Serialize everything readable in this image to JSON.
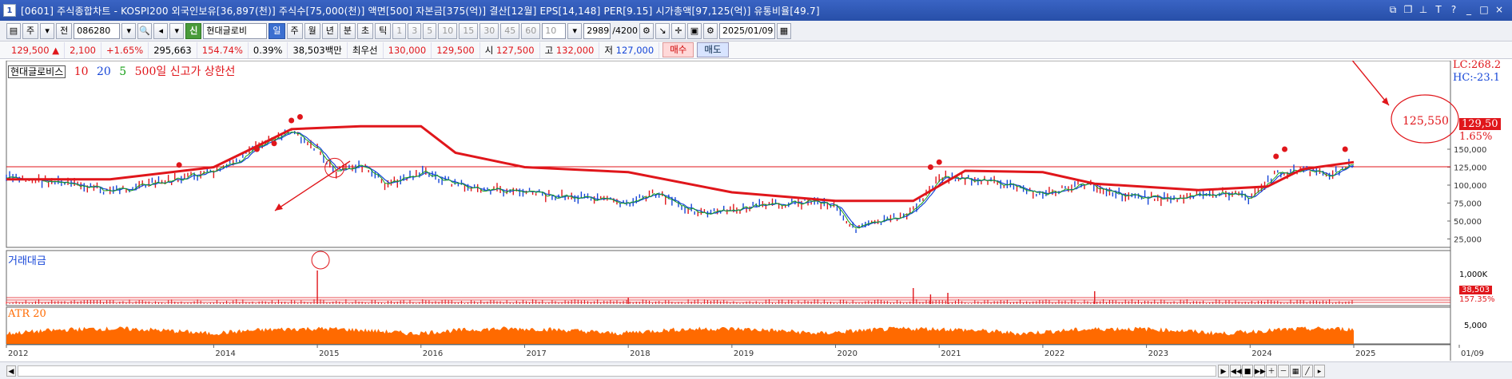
{
  "window": {
    "title": "[0601] 주식종합차트 - KOSPI200 외국인보유[36,897(천)] 주식수[75,000(천)] 액면[500] 자본금[375(억)] 결산[12월] EPS[14,148] PER[9.15] 시가총액[97,125(억)] 유통비율[49.7]",
    "icon": "1"
  },
  "toolbar": {
    "mode": "주",
    "type": "전",
    "code": "086280",
    "sin_label": "신",
    "name": "현대글로비",
    "periods": [
      "일",
      "주",
      "월",
      "년",
      "분",
      "초",
      "틱"
    ],
    "active_period": "일",
    "minutes": [
      "1",
      "3",
      "5",
      "10",
      "15",
      "30",
      "45",
      "60"
    ],
    "min_select": "10",
    "count": "2989",
    "count_total": "/4200",
    "date": "2025/01/09"
  },
  "quote": {
    "price": "129,500",
    "change_arrow": "▲",
    "change": "2,100",
    "change_pct": "+1.65%",
    "volume": "295,663",
    "vol_ratio": "154.74%",
    "turnover": "0.39%",
    "amount": "38,503백만",
    "best_label": "최우선",
    "ask": "130,000",
    "bid": "129,500",
    "open_label": "시",
    "open": "127,500",
    "high_label": "고",
    "high": "132,000",
    "low_label": "저",
    "low": "127,000",
    "buy_label": "매수",
    "sell_label": "매도"
  },
  "panes": {
    "price": {
      "stock_name": "현대글로비스",
      "ma1": "10",
      "ma2": "20",
      "ma3": "5",
      "indicator": "500일 신고가 상한선",
      "lc": "LC:268.2",
      "hc": "HC:-23.1",
      "last_price_tag": "129,50",
      "last_pct": "1.65%",
      "annotation_value": "125,550"
    },
    "volume": {
      "label": "거래대금",
      "value_tag": "38,503",
      "pct": "157.35%",
      "axis": "1,000K"
    },
    "atr": {
      "label": "ATR 20",
      "axis": "5,000"
    }
  },
  "colors": {
    "up": "#e0161b",
    "down": "#1646d8",
    "ma_red": "#e0161b",
    "green": "#18a018",
    "atr": "#ff6a00",
    "accent": "#274fa8"
  },
  "chart_data": {
    "type": "line",
    "title": "현대글로비스",
    "ylim": [
      20000,
      280000
    ],
    "yticks": [
      "150,000",
      "125,000",
      "100,000",
      "75,000",
      "50,000",
      "25,000"
    ],
    "x_labels": [
      "2012",
      "2014",
      "2015",
      "2016",
      "2017",
      "2018",
      "2019",
      "2020",
      "2021",
      "2022",
      "2023",
      "2024",
      "2025",
      "01/09"
    ],
    "price_series": [
      {
        "date": "2012-01",
        "value": 110000
      },
      {
        "date": "2012-07",
        "value": 104000
      },
      {
        "date": "2013-01",
        "value": 92000
      },
      {
        "date": "2013-07",
        "value": 104000
      },
      {
        "date": "2014-01",
        "value": 118000
      },
      {
        "date": "2014-04",
        "value": 135000
      },
      {
        "date": "2014-07",
        "value": 160000
      },
      {
        "date": "2014-10",
        "value": 178000
      },
      {
        "date": "2015-01",
        "value": 150000
      },
      {
        "date": "2015-03",
        "value": 118000
      },
      {
        "date": "2015-06",
        "value": 128000
      },
      {
        "date": "2015-09",
        "value": 100000
      },
      {
        "date": "2016-01",
        "value": 118000
      },
      {
        "date": "2016-07",
        "value": 95000
      },
      {
        "date": "2017-01",
        "value": 90000
      },
      {
        "date": "2017-07",
        "value": 82000
      },
      {
        "date": "2018-01",
        "value": 75000
      },
      {
        "date": "2018-04",
        "value": 88000
      },
      {
        "date": "2018-07",
        "value": 72000
      },
      {
        "date": "2018-10",
        "value": 60000
      },
      {
        "date": "2019-04",
        "value": 70000
      },
      {
        "date": "2019-10",
        "value": 78000
      },
      {
        "date": "2020-01",
        "value": 72000
      },
      {
        "date": "2020-03",
        "value": 40000
      },
      {
        "date": "2020-07",
        "value": 50000
      },
      {
        "date": "2020-10",
        "value": 64000
      },
      {
        "date": "2021-01",
        "value": 112000
      },
      {
        "date": "2021-07",
        "value": 105000
      },
      {
        "date": "2022-01",
        "value": 87000
      },
      {
        "date": "2022-06",
        "value": 102000
      },
      {
        "date": "2022-10",
        "value": 87000
      },
      {
        "date": "2023-04",
        "value": 80000
      },
      {
        "date": "2023-10",
        "value": 90000
      },
      {
        "date": "2024-01",
        "value": 82000
      },
      {
        "date": "2024-04",
        "value": 115000
      },
      {
        "date": "2024-07",
        "value": 122000
      },
      {
        "date": "2024-10",
        "value": 115000
      },
      {
        "date": "2025-01",
        "value": 129500
      }
    ],
    "upper_band": [
      {
        "date": "2012-01",
        "value": 108000
      },
      {
        "date": "2013-01",
        "value": 108000
      },
      {
        "date": "2014-01",
        "value": 125000
      },
      {
        "date": "2014-07",
        "value": 160000
      },
      {
        "date": "2014-10",
        "value": 178000
      },
      {
        "date": "2015-06",
        "value": 182000
      },
      {
        "date": "2016-01",
        "value": 182000
      },
      {
        "date": "2016-05",
        "value": 145000
      },
      {
        "date": "2017-01",
        "value": 125000
      },
      {
        "date": "2018-01",
        "value": 118000
      },
      {
        "date": "2019-01",
        "value": 90000
      },
      {
        "date": "2020-01",
        "value": 78000
      },
      {
        "date": "2020-10",
        "value": 78000
      },
      {
        "date": "2021-04",
        "value": 120000
      },
      {
        "date": "2022-01",
        "value": 118000
      },
      {
        "date": "2022-07",
        "value": 102000
      },
      {
        "date": "2023-07",
        "value": 93000
      },
      {
        "date": "2024-03",
        "value": 98000
      },
      {
        "date": "2024-07",
        "value": 122000
      },
      {
        "date": "2025-01",
        "value": 132000
      }
    ],
    "new_high_marks": [
      {
        "date": "2013-09",
        "value": 128000
      },
      {
        "date": "2014-06",
        "value": 150000
      },
      {
        "date": "2014-08",
        "value": 158000
      },
      {
        "date": "2014-10",
        "value": 190000
      },
      {
        "date": "2014-11",
        "value": 195000
      },
      {
        "date": "2020-12",
        "value": 125000
      },
      {
        "date": "2021-01",
        "value": 132000
      },
      {
        "date": "2024-04",
        "value": 140000
      },
      {
        "date": "2024-05",
        "value": 150000
      },
      {
        "date": "2024-12",
        "value": 150000
      }
    ]
  }
}
